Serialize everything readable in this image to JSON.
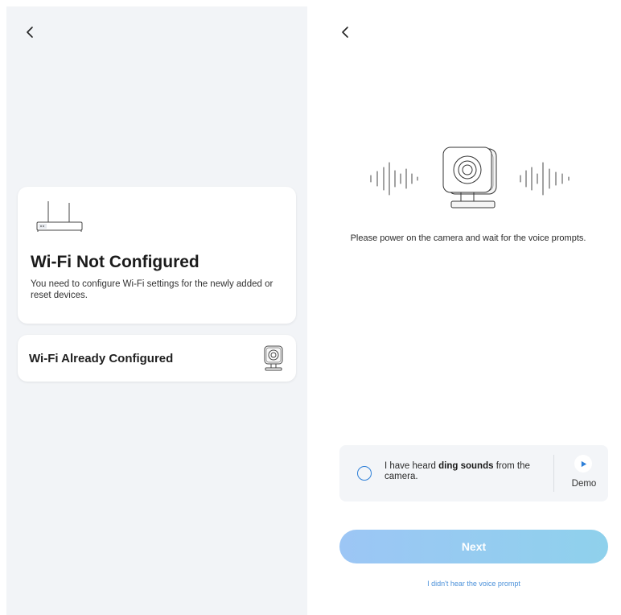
{
  "left_screen": {
    "not_configured_card": {
      "title": "Wi-Fi Not Configured",
      "description": "You need to configure Wi-Fi settings for the newly added or reset devices."
    },
    "already_configured": {
      "label": "Wi-Fi Already Configured"
    }
  },
  "right_screen": {
    "prompt": "Please power on the camera and wait for the voice prompts.",
    "confirm": {
      "text_before": "I have heard ",
      "text_bold": "ding sounds",
      "text_after": " from the camera.",
      "demo_label": "Demo"
    },
    "next_label": "Next",
    "no_prompt_link": "I didn't hear the voice prompt"
  },
  "colors": {
    "accent": "#2d7fd8",
    "next_gradient_start": "#9cc6f5",
    "next_gradient_end": "#8fd1ec",
    "link": "#4a90d9",
    "left_background": "#f2f4f7"
  },
  "icons": [
    "chevron-left-icon",
    "router-icon",
    "camera-icon",
    "sound-wave-icon",
    "play-icon"
  ]
}
